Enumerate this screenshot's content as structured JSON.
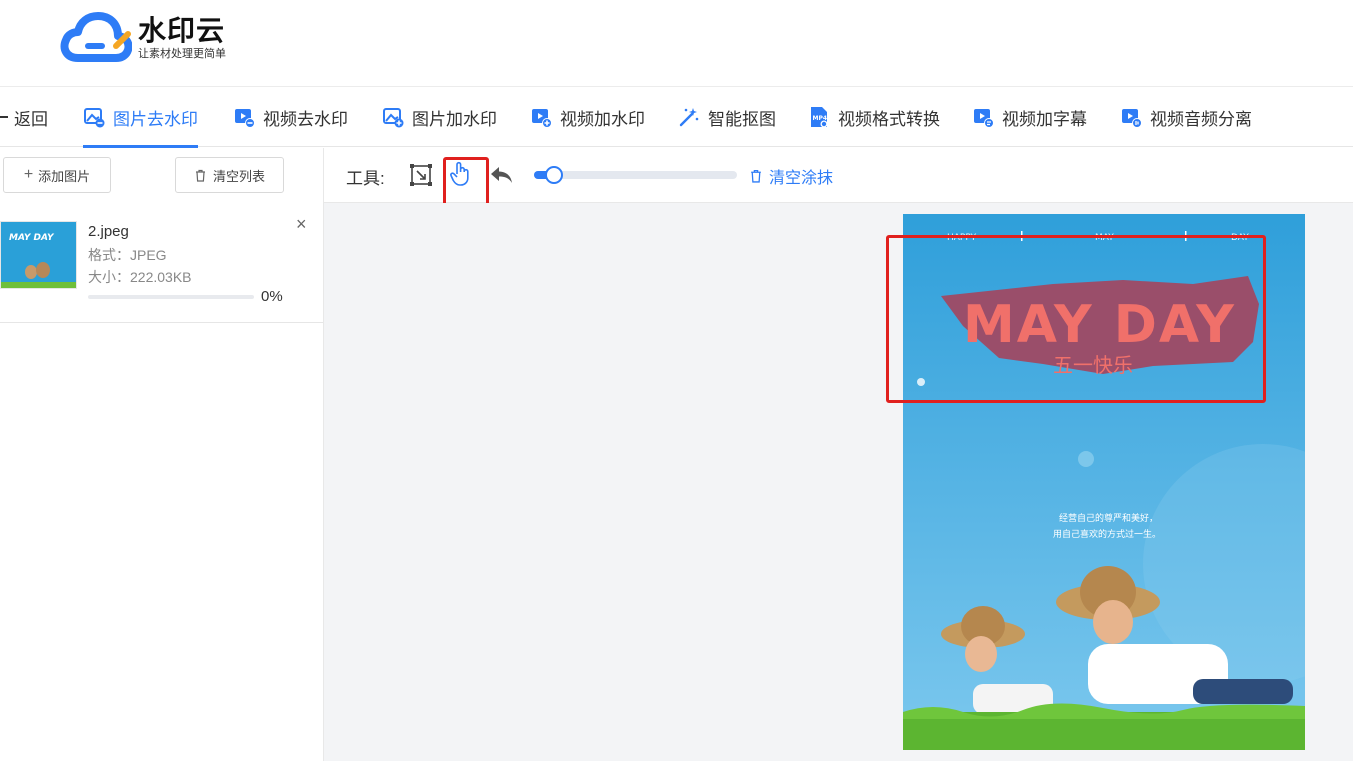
{
  "app": {
    "name": "水印云",
    "slogan": "让素材处理更简单"
  },
  "nav": {
    "back_label": "返回",
    "items": [
      {
        "label": "图片去水印",
        "icon": "image-remove-icon"
      },
      {
        "label": "视频去水印",
        "icon": "video-remove-icon"
      },
      {
        "label": "图片加水印",
        "icon": "image-add-icon"
      },
      {
        "label": "视频加水印",
        "icon": "video-add-icon"
      },
      {
        "label": "智能抠图",
        "icon": "magic-wand-icon"
      },
      {
        "label": "视频格式转换",
        "icon": "mp4-convert-icon"
      },
      {
        "label": "视频加字幕",
        "icon": "video-subtitle-icon"
      },
      {
        "label": "视频音频分离",
        "icon": "video-audio-split-icon"
      }
    ],
    "active_index": 0
  },
  "sidebar": {
    "add_label": "添加图片",
    "clear_list_label": "清空列表",
    "files": [
      {
        "name": "2.jpeg",
        "format": "格式：JPEG",
        "size": "大小：222.03KB",
        "progress_text": "0%",
        "progress": 0
      }
    ]
  },
  "toolbar": {
    "label": "工具:",
    "tools": [
      "rect-select-icon",
      "hand-pan-icon",
      "undo-icon"
    ],
    "brush_size": 0.1,
    "clear_smear_label": "清空涂抹"
  },
  "poster": {
    "top_words": [
      "HAPPY",
      "MAY",
      "DAY"
    ],
    "title": "MAY DAY",
    "subtitle": "五一快乐",
    "quote_line1": "经营自己的尊严和美好，",
    "quote_line2": "用自己喜欢的方式过一生。"
  },
  "colors": {
    "accent": "#2e7cf6",
    "highlight": "#e0201e",
    "poster_sky": "#3aa6de",
    "poster_title": "#f0706a",
    "poster_banner": "#9a4e6a"
  }
}
